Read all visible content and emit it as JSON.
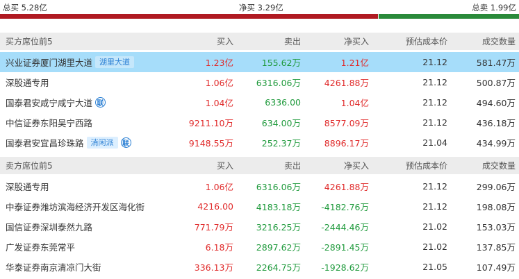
{
  "summary": {
    "total_buy": "总买 5.28亿",
    "net_buy": "净买 3.29亿",
    "total_sell": "总卖 1.99亿"
  },
  "buy_section": {
    "headers": [
      "买方席位前5",
      "买入",
      "卖出",
      "净买入",
      "预估成本价",
      "成交数量"
    ],
    "rows": [
      {
        "name": "兴业证券厦门湖里大道",
        "tag": "湖里大道",
        "lian": "",
        "buy": "1.23亿",
        "sell": "155.62万",
        "net": "1.21亿",
        "cost": "21.12",
        "volume": "581.47万"
      },
      {
        "name": "深股通专用",
        "tag": "",
        "lian": "",
        "buy": "1.06亿",
        "sell": "6316.06万",
        "net": "4261.88万",
        "cost": "21.12",
        "volume": "500.87万"
      },
      {
        "name": "国泰君安咸宁咸宁大道",
        "tag": "",
        "lian": "联",
        "buy": "1.04亿",
        "sell": "6336.00",
        "net": "1.04亿",
        "cost": "21.12",
        "volume": "494.60万"
      },
      {
        "name": "中信证券东阳吴宁西路",
        "tag": "",
        "lian": "",
        "buy": "9211.10万",
        "sell": "634.00万",
        "net": "8577.09万",
        "cost": "21.12",
        "volume": "436.18万"
      },
      {
        "name": "国泰君安宜昌珍珠路",
        "tag": "消闲派",
        "lian": "联",
        "buy": "9148.55万",
        "sell": "252.37万",
        "net": "8896.17万",
        "cost": "21.04",
        "volume": "434.99万"
      }
    ]
  },
  "sell_section": {
    "headers": [
      "卖方席位前5",
      "买入",
      "卖出",
      "净买入",
      "预估成本价",
      "成交数量"
    ],
    "rows": [
      {
        "name": "深股通专用",
        "tag": "",
        "lian": "",
        "buy": "1.06亿",
        "sell": "6316.06万",
        "net": "4261.88万",
        "cost": "21.12",
        "volume": "299.06万"
      },
      {
        "name": "中泰证券潍坊滨海经济开发区海化街",
        "tag": "",
        "lian": "",
        "buy": "4216.00",
        "sell": "4183.18万",
        "net": "-4182.76万",
        "cost": "21.12",
        "volume": "198.08万"
      },
      {
        "name": "国信证券深圳泰然九路",
        "tag": "",
        "lian": "",
        "buy": "771.79万",
        "sell": "3216.25万",
        "net": "-2444.46万",
        "cost": "21.02",
        "volume": "153.03万"
      },
      {
        "name": "广发证券东莞常平",
        "tag": "",
        "lian": "",
        "buy": "6.18万",
        "sell": "2897.62万",
        "net": "-2891.45万",
        "cost": "21.02",
        "volume": "137.85万"
      },
      {
        "name": "华泰证券南京清凉门大街",
        "tag": "",
        "lian": "",
        "buy": "336.13万",
        "sell": "2264.75万",
        "net": "-1928.62万",
        "cost": "21.05",
        "volume": "107.49万"
      }
    ]
  },
  "colors": {
    "up": "#e02a2a",
    "down": "#1f9a3c",
    "highlight": "#a6ddfa",
    "tag_text": "#2a7fd4"
  }
}
